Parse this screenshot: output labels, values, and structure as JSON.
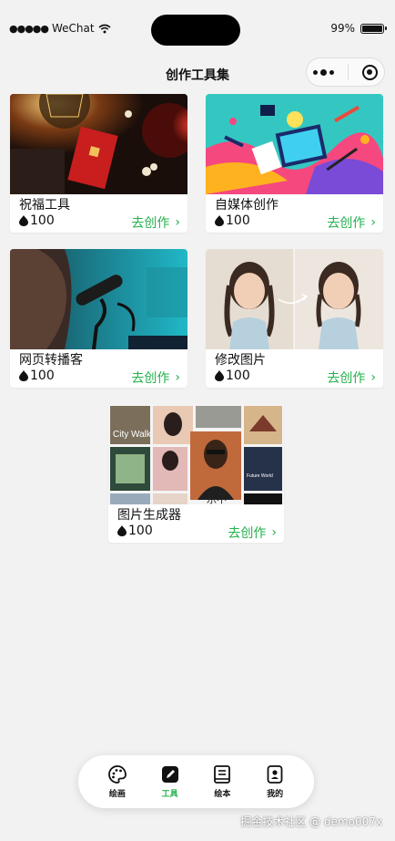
{
  "status": {
    "carrier": "WeChat",
    "battery_percent": "99%",
    "battery_level": 0.99
  },
  "nav": {
    "title": "创作工具集"
  },
  "cards": [
    {
      "title": "祝福工具",
      "cost": "100",
      "action": "去创作"
    },
    {
      "title": "自媒体创作",
      "cost": "100",
      "action": "去创作"
    },
    {
      "title": "网页转播客",
      "cost": "100",
      "action": "去创作"
    },
    {
      "title": "修改图片",
      "cost": "100",
      "action": "去创作"
    },
    {
      "title": "图片生成器",
      "cost": "100",
      "action": "去创作",
      "image_text": [
        "City Walk",
        "Future World",
        "乐不"
      ]
    }
  ],
  "tabbar": {
    "active_color": "#22b14c",
    "items": [
      {
        "label": "绘画",
        "icon": "palette-icon"
      },
      {
        "label": "工具",
        "icon": "edit-icon"
      },
      {
        "label": "绘本",
        "icon": "book-icon"
      },
      {
        "label": "我的",
        "icon": "profile-icon"
      }
    ]
  },
  "watermark": "掘金技术社区 @ demo007x"
}
